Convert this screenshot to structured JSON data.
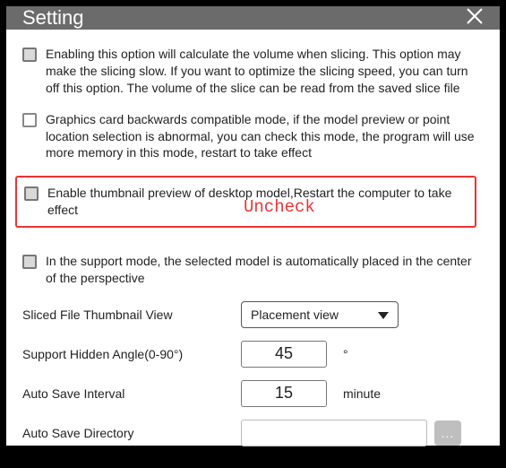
{
  "title": "Setting",
  "options": {
    "volume": "Enabling this option will calculate the volume when slicing. This option may make the slicing slow. If you want to optimize the slicing speed, you can turn off this option. The volume of the slice can be read from the saved slice file",
    "graphics": "Graphics card backwards compatible mode, if the model preview or point location selection is abnormal, you can check this mode, the program will use more memory in this mode, restart to take effect",
    "thumbnail": "Enable thumbnail preview of desktop model,Restart the computer to take effect",
    "support_center": "In the support mode, the selected model is automatically placed in the center of the perspective"
  },
  "annotation": "Uncheck",
  "form": {
    "sliced_view_label": "Sliced File Thumbnail View",
    "sliced_view_value": "Placement view",
    "hidden_angle_label": "Support Hidden Angle(0-90°)",
    "hidden_angle_value": "45",
    "hidden_angle_unit": "°",
    "autosave_label": "Auto Save Interval",
    "autosave_value": "15",
    "autosave_unit": "minute",
    "autosave_dir_label": "Auto Save Directory",
    "autosave_dir_value": "",
    "browse": "..."
  }
}
